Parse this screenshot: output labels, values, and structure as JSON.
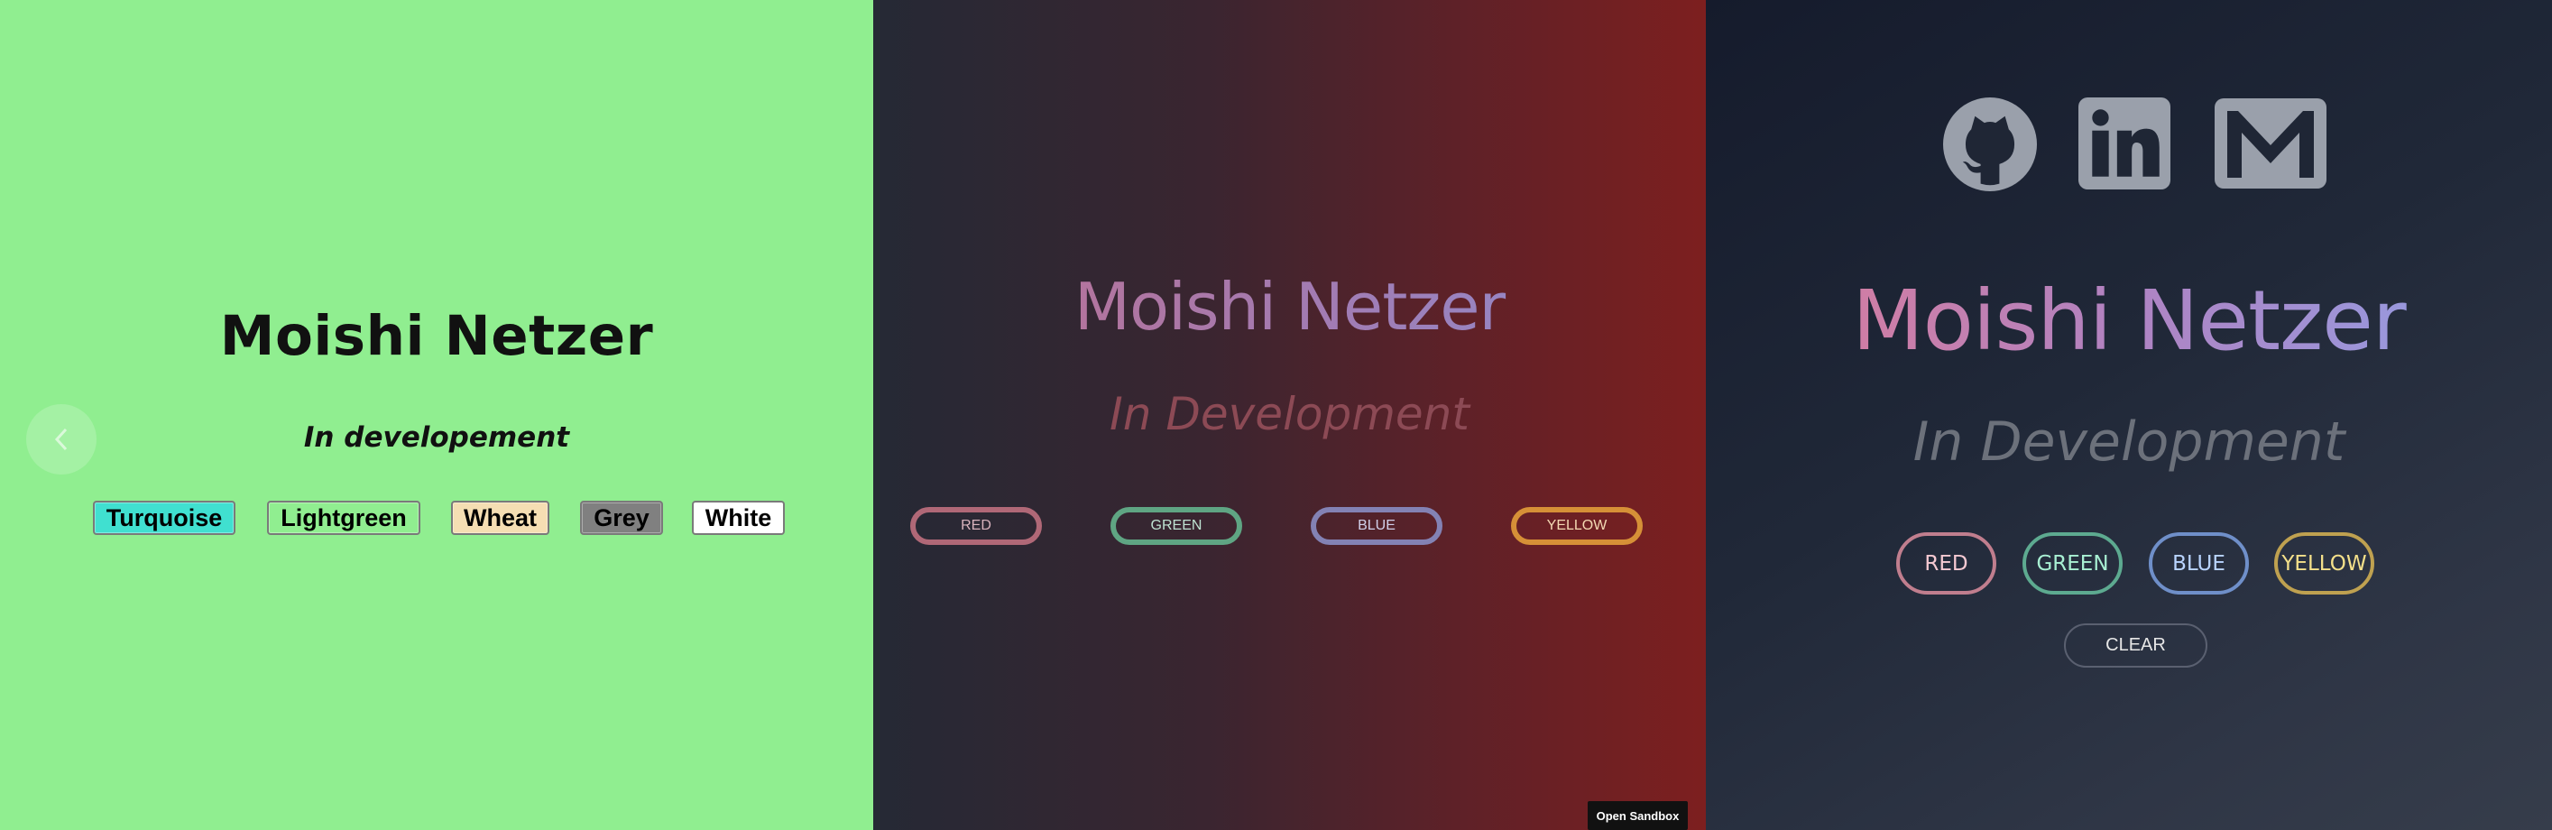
{
  "panel1": {
    "title": "Moishi Netzer",
    "subtitle": "In developement",
    "buttons": [
      {
        "label": "Turquoise",
        "color": "#40e0d0"
      },
      {
        "label": "Lightgreen",
        "color": "#90ee90"
      },
      {
        "label": "Wheat",
        "color": "#f5deb3"
      },
      {
        "label": "Grey",
        "color": "#808080"
      },
      {
        "label": "White",
        "color": "#ffffff"
      }
    ],
    "background": "#90ee90",
    "back_icon": "chevron-left-icon"
  },
  "panel2": {
    "title": "Moishi Netzer",
    "subtitle": "In Development",
    "buttons": [
      {
        "label": "RED",
        "color": "#b06877"
      },
      {
        "label": "GREEN",
        "color": "#5fa583"
      },
      {
        "label": "BLUE",
        "color": "#8382b4"
      },
      {
        "label": "YELLOW",
        "color": "#d69037"
      }
    ],
    "open_sandbox": "Open Sandbox"
  },
  "panel3": {
    "social_icons": [
      "github-icon",
      "linkedin-icon",
      "gmail-icon"
    ],
    "icon_color": "#9aa0ab",
    "title": "Moishi Netzer",
    "subtitle": "In Development",
    "buttons": [
      {
        "label": "RED",
        "color": "#c07e8e",
        "text_color": "#f5c9d2"
      },
      {
        "label": "GREEN",
        "color": "#5daa90",
        "text_color": "#a8f0d3"
      },
      {
        "label": "BLUE",
        "color": "#6f8fc9",
        "text_color": "#b9d4ff"
      },
      {
        "label": "YELLOW",
        "color": "#bfa150",
        "text_color": "#f4e08a"
      }
    ],
    "clear_label": "CLEAR"
  }
}
